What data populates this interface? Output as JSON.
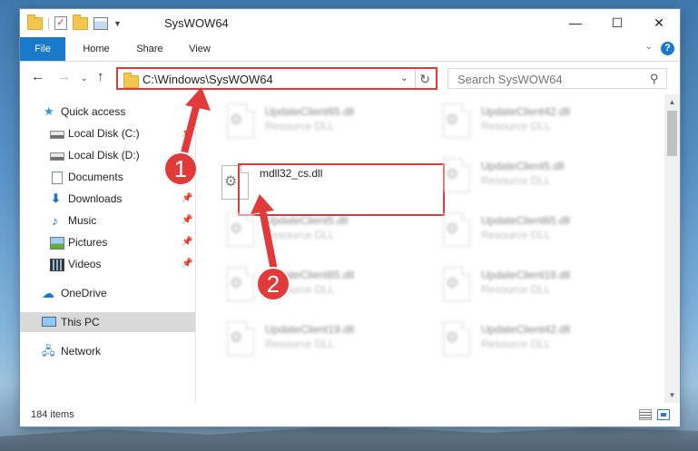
{
  "window": {
    "title": "SysWOW64",
    "controls": {
      "minimize": "—",
      "maximize": "☐",
      "close": "✕"
    }
  },
  "ribbon": {
    "tabs": [
      "File",
      "Home",
      "Share",
      "View"
    ],
    "help": "?"
  },
  "navbar": {
    "address": "C:\\Windows\\SysWOW64",
    "search_placeholder": "Search SysWOW64"
  },
  "sidebar": {
    "items": [
      {
        "label": "Quick access",
        "icon": "star-icon"
      },
      {
        "label": "Local Disk (C:)",
        "icon": "drive-icon",
        "pinned": true
      },
      {
        "label": "Local Disk (D:)",
        "icon": "drive-icon",
        "pinned": false
      },
      {
        "label": "Documents",
        "icon": "documents-icon",
        "pinned": true
      },
      {
        "label": "Downloads",
        "icon": "downloads-icon",
        "pinned": true
      },
      {
        "label": "Music",
        "icon": "music-icon",
        "pinned": true
      },
      {
        "label": "Pictures",
        "icon": "pictures-icon",
        "pinned": true
      },
      {
        "label": "Videos",
        "icon": "videos-icon",
        "pinned": true
      },
      {
        "label": "OneDrive",
        "icon": "onedrive-icon"
      },
      {
        "label": "This PC",
        "icon": "this-pc-icon",
        "selected": true
      },
      {
        "label": "Network",
        "icon": "network-icon"
      }
    ]
  },
  "files": {
    "highlighted": {
      "name": "mdll32_cs.dll"
    },
    "background": [
      {
        "name": "UpdateClient65.dll",
        "type": "Resource DLL"
      },
      {
        "name": "UpdateClient42.dll",
        "type": "Resource DLL"
      },
      {
        "name": "UpdateClient5.dll",
        "type": "Resource DLL"
      },
      {
        "name": "UpdateClient5.dll",
        "type": "Resource DLL"
      },
      {
        "name": "UpdateClient65.dll",
        "type": "Resource DLL"
      },
      {
        "name": "UpdateClient65.dll",
        "type": "Resource DLL"
      },
      {
        "name": "UpdateClient19.dll",
        "type": "Resource DLL"
      },
      {
        "name": "UpdateClient19.dll",
        "type": "Resource DLL"
      },
      {
        "name": "UpdateClient42.dll",
        "type": "Resource DLL"
      }
    ]
  },
  "status": {
    "item_count": "184 items"
  },
  "annotations": {
    "step1": "1",
    "step2": "2",
    "color": "#e03a3a"
  }
}
